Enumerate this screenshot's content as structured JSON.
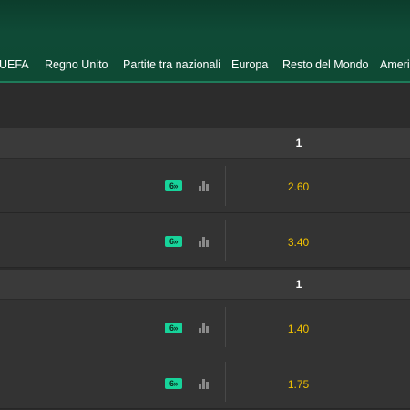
{
  "nav": {
    "items": [
      "UEFA",
      "Regno Unito",
      "Partite tra nazionali",
      "Europa",
      "Resto del Mondo",
      "Americ"
    ]
  },
  "sections": [
    {
      "header": "1",
      "rows": [
        {
          "badge": "6»",
          "odds": "2.60"
        },
        {
          "badge": "6»",
          "odds": "3.40"
        }
      ]
    },
    {
      "header": "1",
      "rows": [
        {
          "badge": "6»",
          "odds": "1.40"
        },
        {
          "badge": "6»",
          "odds": "1.75"
        }
      ]
    }
  ],
  "colors": {
    "topbar": "#0e4a34",
    "accent_badge": "#17d39a",
    "odds_text": "#f2c200",
    "row_bg": "#333333",
    "header_bg": "#3a3a3a"
  },
  "icons": {
    "stats": "bar-chart-icon",
    "badge": "bet-builder-badge"
  }
}
